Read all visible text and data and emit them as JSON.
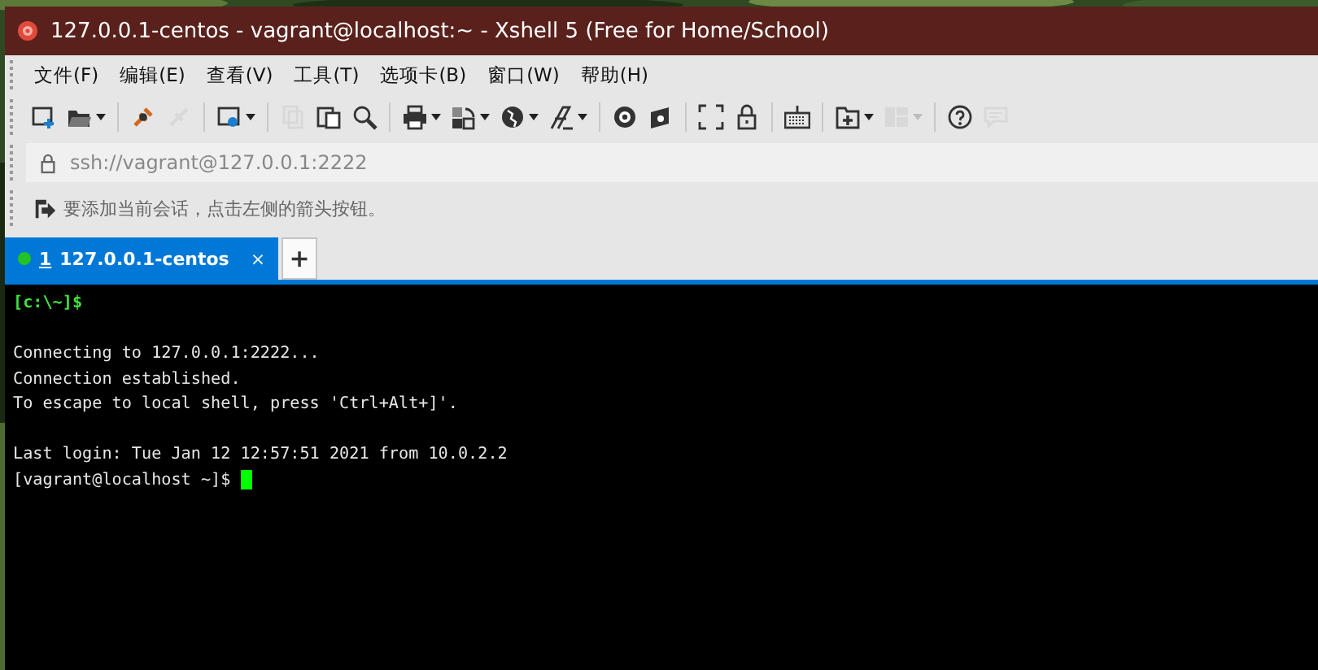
{
  "window": {
    "title": "127.0.0.1-centos - vagrant@localhost:~ - Xshell 5 (Free for Home/School)"
  },
  "menu": [
    "文件(F)",
    "编辑(E)",
    "查看(V)",
    "工具(T)",
    "选项卡(B)",
    "窗口(W)",
    "帮助(H)"
  ],
  "toolbar": [
    {
      "kind": "button",
      "disabled": false,
      "dropdown": false
    },
    {
      "kind": "button",
      "disabled": false,
      "dropdown": true
    },
    {
      "kind": "separator"
    },
    {
      "kind": "button",
      "disabled": false,
      "dropdown": false
    },
    {
      "kind": "button",
      "disabled": true,
      "dropdown": false
    },
    {
      "kind": "separator"
    },
    {
      "kind": "button",
      "disabled": false,
      "dropdown": true
    },
    {
      "kind": "separator"
    },
    {
      "kind": "button",
      "disabled": true,
      "dropdown": false
    },
    {
      "kind": "button",
      "disabled": false,
      "dropdown": false
    },
    {
      "kind": "button",
      "disabled": false,
      "dropdown": false
    },
    {
      "kind": "separator"
    },
    {
      "kind": "button",
      "disabled": false,
      "dropdown": true
    },
    {
      "kind": "button",
      "disabled": false,
      "dropdown": true
    },
    {
      "kind": "button",
      "disabled": false,
      "dropdown": true
    },
    {
      "kind": "button",
      "disabled": false,
      "dropdown": true
    },
    {
      "kind": "separator"
    },
    {
      "kind": "button",
      "disabled": false,
      "dropdown": false
    },
    {
      "kind": "button",
      "disabled": false,
      "dropdown": false
    },
    {
      "kind": "separator"
    },
    {
      "kind": "button",
      "disabled": false,
      "dropdown": false
    },
    {
      "kind": "button",
      "disabled": false,
      "dropdown": false
    },
    {
      "kind": "separator"
    },
    {
      "kind": "button",
      "disabled": false,
      "dropdown": false
    },
    {
      "kind": "separator"
    },
    {
      "kind": "button",
      "disabled": false,
      "dropdown": true
    },
    {
      "kind": "button",
      "disabled": true,
      "dropdown": true
    },
    {
      "kind": "separator"
    },
    {
      "kind": "button",
      "disabled": false,
      "dropdown": false
    },
    {
      "kind": "button",
      "disabled": true,
      "dropdown": false
    }
  ],
  "address_bar": {
    "value": "ssh://vagrant@127.0.0.1:2222"
  },
  "hint_bar": {
    "text": "要添加当前会话，点击左侧的箭头按钮。"
  },
  "tabs": [
    {
      "number": "1",
      "title": "127.0.0.1-centos",
      "close": "×",
      "selected": true,
      "connected": true
    }
  ],
  "new_tab": "+",
  "terminal": [
    {
      "kind": "prompt",
      "text": "[c:\\~]$"
    },
    {
      "kind": "blank"
    },
    {
      "kind": "output",
      "text": "Connecting to 127.0.0.1:2222..."
    },
    {
      "kind": "output",
      "text": "Connection established."
    },
    {
      "kind": "output",
      "text": "To escape to local shell, press 'Ctrl+Alt+]'."
    },
    {
      "kind": "blank"
    },
    {
      "kind": "output",
      "text": "Last login: Tue Jan 12 12:57:51 2021 from 10.0.2.2"
    },
    {
      "kind": "output",
      "text": "[vagrant@localhost ~]$ ",
      "cursor": true
    }
  ]
}
